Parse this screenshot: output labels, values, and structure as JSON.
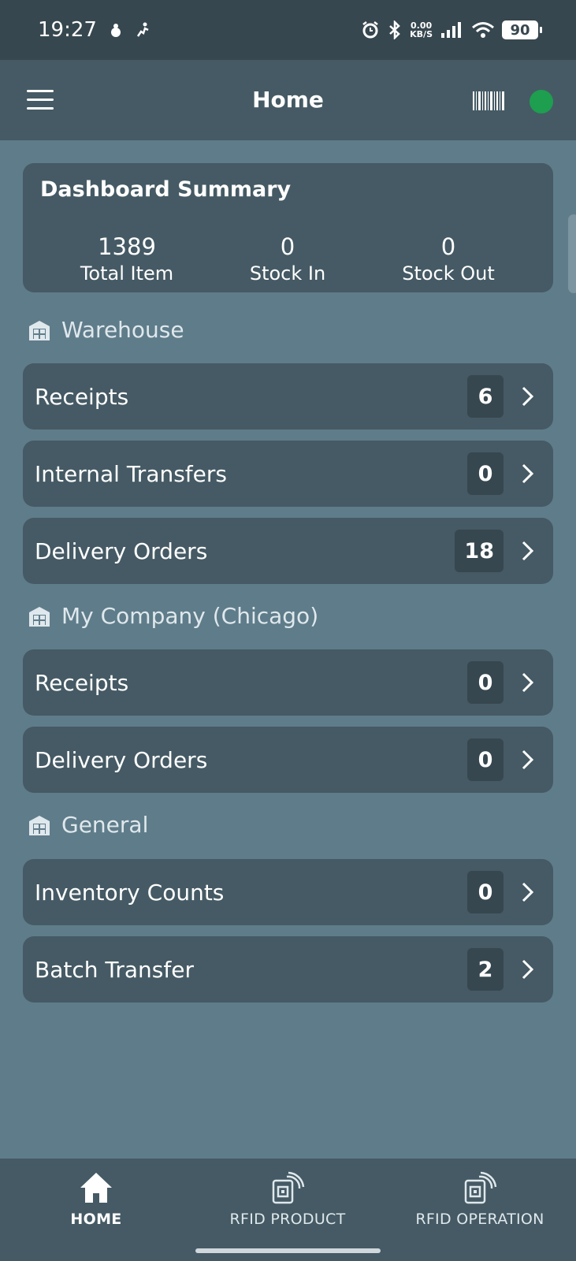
{
  "status_bar": {
    "time": "19:27",
    "net_speed_value": "0.00",
    "net_speed_unit": "KB/S",
    "battery": "90"
  },
  "header": {
    "title": "Home",
    "connection_status_color": "#1e9e4f"
  },
  "summary": {
    "title": "Dashboard Summary",
    "stats": [
      {
        "value": "1389",
        "label": "Total Item"
      },
      {
        "value": "0",
        "label": "Stock In"
      },
      {
        "value": "0",
        "label": "Stock Out"
      }
    ]
  },
  "sections": [
    {
      "title": "Warehouse",
      "icon": "warehouse-icon",
      "items": [
        {
          "label": "Receipts",
          "count": "6"
        },
        {
          "label": "Internal Transfers",
          "count": "0"
        },
        {
          "label": "Delivery Orders",
          "count": "18"
        }
      ]
    },
    {
      "title": "My Company (Chicago)",
      "icon": "warehouse-icon",
      "items": [
        {
          "label": "Receipts",
          "count": "0"
        },
        {
          "label": "Delivery Orders",
          "count": "0"
        }
      ]
    },
    {
      "title": "General",
      "icon": "warehouse-icon",
      "items": [
        {
          "label": "Inventory Counts",
          "count": "0"
        },
        {
          "label": "Batch Transfer",
          "count": "2"
        }
      ]
    }
  ],
  "bottom_nav": {
    "items": [
      {
        "label": "HOME",
        "icon": "home-icon",
        "active": true
      },
      {
        "label": "RFID PRODUCT",
        "icon": "rfid-icon",
        "active": false
      },
      {
        "label": "RFID OPERATION",
        "icon": "rfid-icon",
        "active": false
      }
    ]
  }
}
